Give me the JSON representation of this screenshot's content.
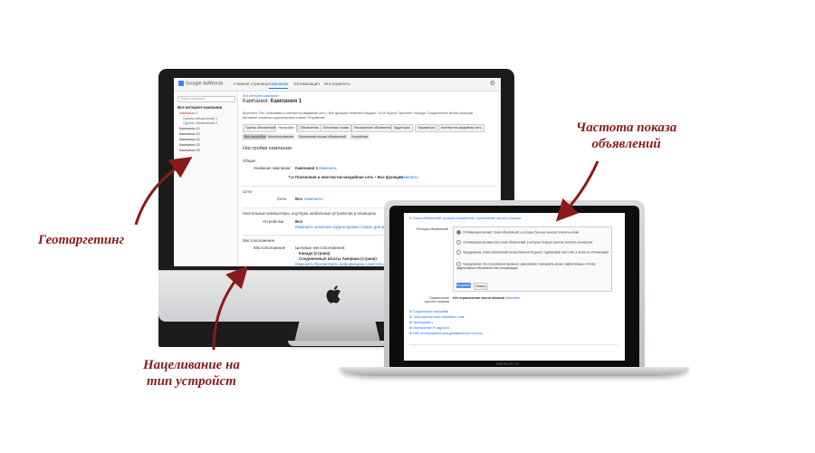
{
  "adwords": {
    "logo": "Google AdWords",
    "nav": [
      "Главная страница",
      "Кампании",
      "Оптимизация",
      "Инструменты"
    ],
    "active_nav": 1,
    "sidebar": {
      "search_placeholder": "Поиск кампаний",
      "header": "Все интернет-кампании",
      "items": [
        "Кампания 1",
        "Группы объявлений 1",
        "Группы объявлений 2",
        "Кампания 12",
        "Кампания 13",
        "Кампания 14",
        "Кампания 15",
        "Кампания 16"
      ]
    },
    "breadcrumb": "Все интернет-кампании",
    "campaign_prefix": "Кампания:",
    "campaign_name": "Кампания 1",
    "info_line_1": "Включено   Тип: Поисковая и контекстно-медийная сеть • Все функции  Изменить   Бюджет: 10,00 $/день   Таргетинг: Канада; Соединенные Штаты Америки",
    "info_line_2": "Активные значения корректировок ставок: Устройства",
    "tabs": [
      "Группы объявлений",
      "Настройки",
      "Объявления",
      "Ключевые слова",
      "Расширения объявлений",
      "Аудитории",
      "Параметры",
      "Контекстно-медийная сеть"
    ],
    "active_tab": 1,
    "subtabs": [
      "Все настройки",
      "Местоположения",
      "Расписание показа объявлений",
      "Устройства"
    ],
    "active_subtab": 0,
    "section_title": "Настройки кампании",
    "general_header": "Общие",
    "name_label": "Название кампании",
    "name_value": "Кампания 1",
    "edit_link": "Изменить",
    "type_label": "Тип",
    "type_value": "Поисковая и контекстно-медийная сеть • Все функции",
    "networks_header": "Сети",
    "networks_label": "Сети",
    "networks_value": "Все",
    "devices_header": "Настольные компьютеры, ноутбуки, мобильные устройства и планшеты",
    "devices_label": "Устройства",
    "devices_value": "Все",
    "devices_link": "Изменить значения корректировки ставок для мобил",
    "location_header": "Местоположение",
    "location_label": "Местоположения",
    "location_target_title": "Целевые местоположения:",
    "location_values": [
      "Канада (страна)",
      "Соединенные Штаты Америки (страна)"
    ],
    "location_links": "Изменить   Просмотреть информацию о местоположениях"
  },
  "macbook": {
    "label": "MacBook Air",
    "header_link": "Показ объявлений: ротация объявлений, ограничение частоты показов",
    "rotation_label": "Ротация объявлений",
    "rotation_options": [
      "Оптимизация (клики): показ объявлений, у которых больше шансов получить клики",
      "Оптимизация (конверсии): показ объявлений, у которых больше шансов получить конверсию",
      "Чередование: показ объявлений на протяжении 90 дней с одинаковой частотой, а затем их оптимизация",
      "Чередование: без ограничения времени: равномерно показывать менее эффективные и более эффективные объявления без оптимизации"
    ],
    "save_label": "Сохранить",
    "cancel_label": "Отмена",
    "frequency_label": "Ограничение частоты показов",
    "frequency_value": "Нет ограничения числа показов",
    "frequency_link": "Изменить",
    "links": [
      "Социальные настройки",
      "Типы контекстных ключевых слов",
      "Эксперимент",
      "Исключение IP-адресов",
      "URL отслеживания для динамических ссылок"
    ]
  },
  "annotations": {
    "frequency": [
      "Частота показа",
      "объявлений"
    ],
    "geo": "Геотаргетинг",
    "devices": [
      "Нацеливание на",
      "тип устройст"
    ]
  },
  "colors": {
    "annotation": "#8b1a1a",
    "link": "#1a73e8"
  }
}
